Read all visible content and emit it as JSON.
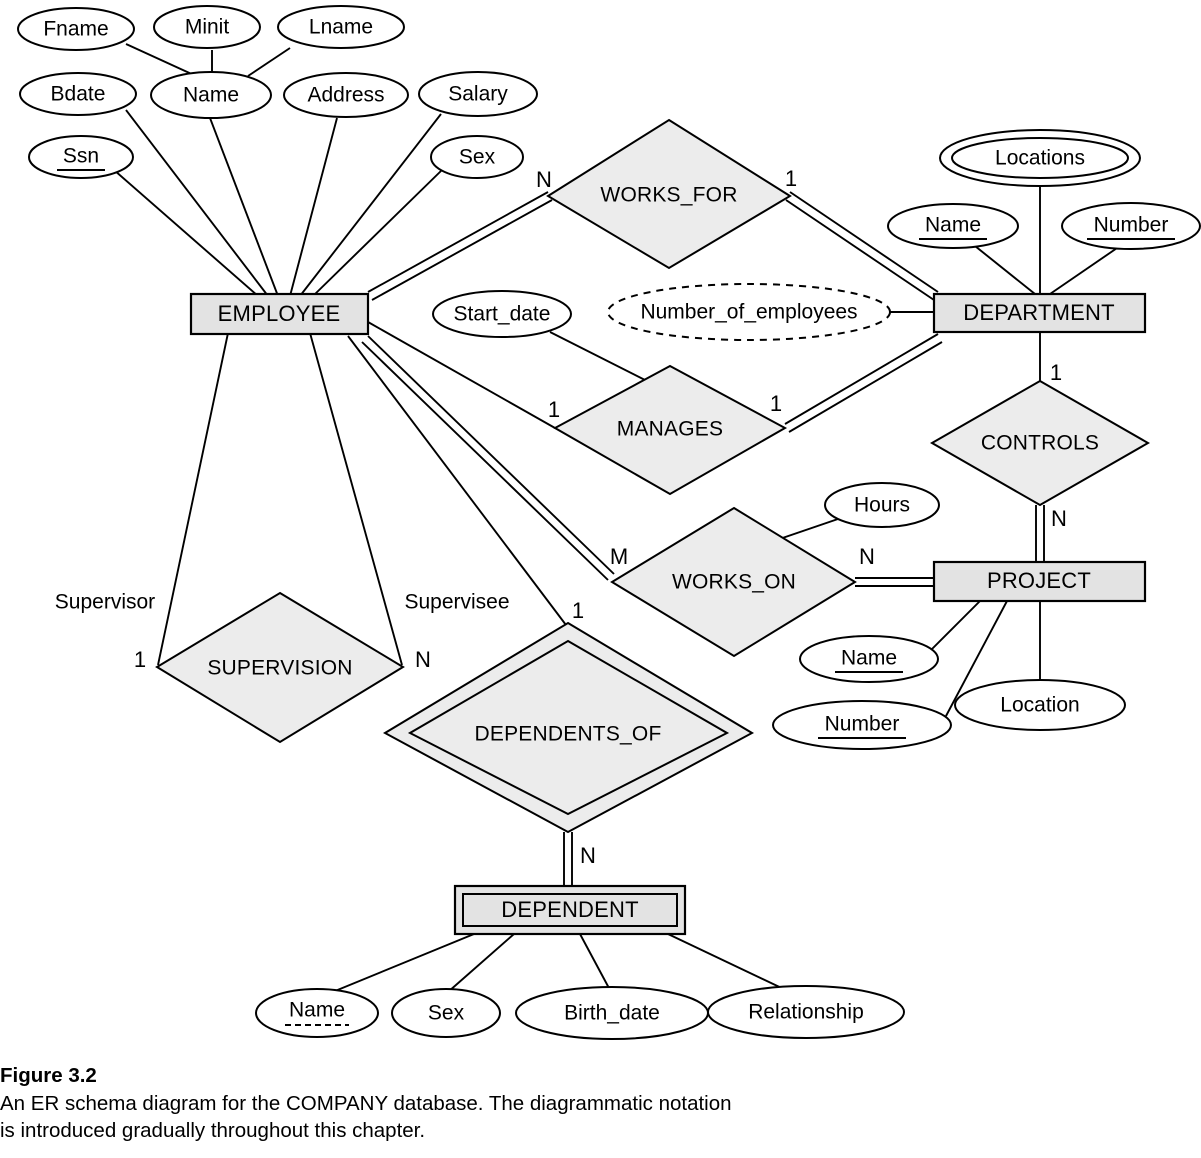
{
  "figure": {
    "number": "Figure 3.2",
    "caption_line1": "An ER schema diagram for the COMPANY database. The diagrammatic notation",
    "caption_line2": "is introduced gradually throughout this chapter."
  },
  "colors": {
    "entity_fill": "#e3e3e3",
    "relationship_fill": "#ececec",
    "attribute_fill": "#ffffff",
    "stroke": "#000000",
    "background": "#ffffff"
  },
  "entities": {
    "employee": {
      "label": "EMPLOYEE",
      "weak": false
    },
    "department": {
      "label": "DEPARTMENT",
      "weak": false
    },
    "project": {
      "label": "PROJECT",
      "weak": false
    },
    "dependent": {
      "label": "DEPENDENT",
      "weak": true
    }
  },
  "relationships": {
    "works_for": {
      "label": "WORKS_FOR",
      "identifying": false
    },
    "manages": {
      "label": "MANAGES",
      "identifying": false
    },
    "works_on": {
      "label": "WORKS_ON",
      "identifying": false
    },
    "controls": {
      "label": "CONTROLS",
      "identifying": false
    },
    "supervision": {
      "label": "SUPERVISION",
      "identifying": false
    },
    "dependents_of": {
      "label": "DEPENDENTS_OF",
      "identifying": true
    }
  },
  "attributes": {
    "employee": {
      "fname": {
        "label": "Fname",
        "key": false
      },
      "minit": {
        "label": "Minit",
        "key": false
      },
      "lname": {
        "label": "Lname",
        "key": false
      },
      "bdate": {
        "label": "Bdate",
        "key": false
      },
      "name": {
        "label": "Name",
        "key": false,
        "composite": true
      },
      "address": {
        "label": "Address",
        "key": false
      },
      "salary": {
        "label": "Salary",
        "key": false
      },
      "ssn": {
        "label": "Ssn",
        "key": true
      },
      "sex": {
        "label": "Sex",
        "key": false
      }
    },
    "department": {
      "locations": {
        "label": "Locations",
        "key": false,
        "multivalued": true
      },
      "name": {
        "label": "Name",
        "key": true
      },
      "number": {
        "label": "Number",
        "key": true
      },
      "number_of_employees": {
        "label": "Number_of_employees",
        "key": false,
        "derived": true
      }
    },
    "project": {
      "name": {
        "label": "Name",
        "key": true
      },
      "number": {
        "label": "Number",
        "key": true
      },
      "location": {
        "label": "Location",
        "key": false
      }
    },
    "dependent": {
      "name": {
        "label": "Name",
        "partial_key": true
      },
      "sex": {
        "label": "Sex",
        "key": false
      },
      "birth_date": {
        "label": "Birth_date",
        "key": false
      },
      "relationship": {
        "label": "Relationship",
        "key": false
      }
    },
    "works_for_rel": {},
    "manages_rel": {
      "start_date": {
        "label": "Start_date",
        "key": false
      }
    },
    "works_on_rel": {
      "hours": {
        "label": "Hours",
        "key": false
      }
    }
  },
  "cardinalities": {
    "works_for_employee": "N",
    "works_for_department": "1",
    "manages_employee": "1",
    "manages_department": "1",
    "works_on_employee": "M",
    "works_on_project": "N",
    "controls_department": "1",
    "controls_project": "N",
    "supervision_supervisor": "1",
    "supervision_supervisee": "N",
    "dependents_of_employee": "1",
    "dependents_of_dependent": "N"
  },
  "roles": {
    "supervisor": "Supervisor",
    "supervisee": "Supervisee"
  }
}
